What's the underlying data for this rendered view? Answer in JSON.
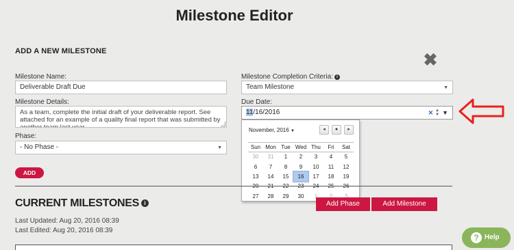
{
  "page": {
    "title": "Milestone Editor"
  },
  "new_milestone": {
    "heading": "ADD A NEW MILESTONE",
    "name_label": "Milestone Name:",
    "name_value": "Deliverable Draft Due",
    "details_label": "Milestone Details:",
    "details_value": "As a team, complete the initial draft of your deliverable report. See attached for an example of a quality final report that was submitted by another team last year.",
    "phase_label": "Phase:",
    "phase_value": "- No Phase -",
    "criteria_label": "Milestone Completion Criteria:",
    "criteria_value": "Team Milestone",
    "due_label": "Due Date:",
    "due_month": "11",
    "due_rest": "/16/2016",
    "add_button": "ADD"
  },
  "calendar": {
    "month_label": "November, 2016",
    "weekdays": [
      "Sun",
      "Mon",
      "Tue",
      "Wed",
      "Thu",
      "Fri",
      "Sat"
    ],
    "weeks": [
      [
        "30",
        "31",
        "1",
        "2",
        "3",
        "4",
        "5"
      ],
      [
        "6",
        "7",
        "8",
        "9",
        "10",
        "11",
        "12"
      ],
      [
        "13",
        "14",
        "15",
        "16",
        "17",
        "18",
        "19"
      ],
      [
        "20",
        "21",
        "22",
        "23",
        "24",
        "25",
        "26"
      ],
      [
        "27",
        "28",
        "29",
        "30",
        "1",
        "2",
        "3"
      ]
    ],
    "selected_day": "16"
  },
  "current": {
    "heading": "CURRENT MILESTONES",
    "last_updated": "Last Updated: Aug 20, 2016 08:39",
    "last_edited": "Last Edited: Aug 20, 2016 08:39",
    "add_phase": "Add Phase",
    "add_milestone": "Add Milestone"
  },
  "help": {
    "label": "Help"
  },
  "colors": {
    "accent": "#cc1743",
    "annotation_arrow": "#e8201f",
    "help_green": "#8bb55a",
    "date_highlight": "#aecbee",
    "background": "#ebebea"
  }
}
